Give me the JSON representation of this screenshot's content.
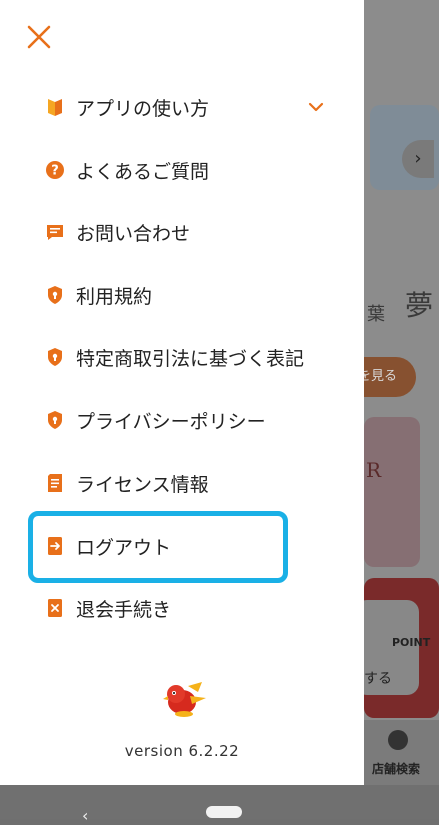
{
  "menu": {
    "items": [
      {
        "label": "アプリの使い方",
        "icon": "guide-book-icon"
      },
      {
        "label": "よくあるご質問",
        "icon": "question-circle-icon"
      },
      {
        "label": "お問い合わせ",
        "icon": "chat-bubble-icon"
      },
      {
        "label": "利用規約",
        "icon": "shield-lock-icon"
      },
      {
        "label": "特定商取引法に基づく表記",
        "icon": "shield-lock-icon"
      },
      {
        "label": "プライバシーポリシー",
        "icon": "shield-lock-icon"
      },
      {
        "label": "ライセンス情報",
        "icon": "document-icon"
      },
      {
        "label": "ログアウト",
        "icon": "logout-icon"
      },
      {
        "label": "退会手続き",
        "icon": "withdraw-icon"
      }
    ]
  },
  "version_text": "version 6.2.22",
  "background": {
    "kanji": "夢",
    "kanji_small": "葉",
    "see_more_partial": "を見る",
    "promo_partial": "R",
    "point_label": "POINT",
    "suru_partial": "する",
    "store_search_label": "店舗検索"
  },
  "colors": {
    "accent": "#e8701a",
    "highlight": "#1ab0e6",
    "drawer_bg": "#ffffff"
  }
}
